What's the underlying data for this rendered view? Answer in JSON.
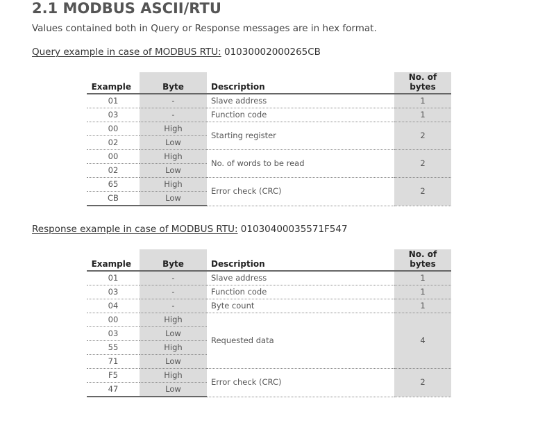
{
  "page": {
    "title": "2.1 MODBUS ASCII/RTU",
    "intro": "Values contained both in Query or Response messages are in hex format."
  },
  "query": {
    "label": "Query example in case of MODBUS RTU:",
    "value": "01030002000265CB",
    "headers": [
      "Example",
      "Byte",
      "Description",
      "No. of bytes"
    ],
    "rows": [
      {
        "example": "01",
        "byte": "-",
        "description": "Slave address",
        "bytes": "1"
      },
      {
        "example": "03",
        "byte": "-",
        "description": "Function code",
        "bytes": "1"
      },
      {
        "example": "00",
        "byte": "High",
        "description": "Starting register",
        "bytes": "2"
      },
      {
        "example": "02",
        "byte": "Low"
      },
      {
        "example": "00",
        "byte": "High",
        "description": "No. of words to be read",
        "bytes": "2"
      },
      {
        "example": "02",
        "byte": "Low"
      },
      {
        "example": "65",
        "byte": "High",
        "description": "Error check (CRC)",
        "bytes": "2"
      },
      {
        "example": "CB",
        "byte": "Low"
      }
    ]
  },
  "response": {
    "label": "Response example in case of MODBUS RTU:",
    "value": "01030400035571F547",
    "headers": [
      "Example",
      "Byte",
      "Description",
      "No. of bytes"
    ],
    "rows": [
      {
        "example": "01",
        "byte": "-",
        "description": "Slave address",
        "bytes": "1"
      },
      {
        "example": "03",
        "byte": "-",
        "description": "Function code",
        "bytes": "1"
      },
      {
        "example": "04",
        "byte": "-",
        "description": "Byte count",
        "bytes": "1"
      },
      {
        "example": "00",
        "byte": "High",
        "description": "Requested data",
        "bytes": "4"
      },
      {
        "example": "03",
        "byte": "Low"
      },
      {
        "example": "55",
        "byte": "High"
      },
      {
        "example": "71",
        "byte": "Low"
      },
      {
        "example": "F5",
        "byte": "High",
        "description": "Error check (CRC)",
        "bytes": "2"
      },
      {
        "example": "47",
        "byte": "Low"
      }
    ]
  }
}
